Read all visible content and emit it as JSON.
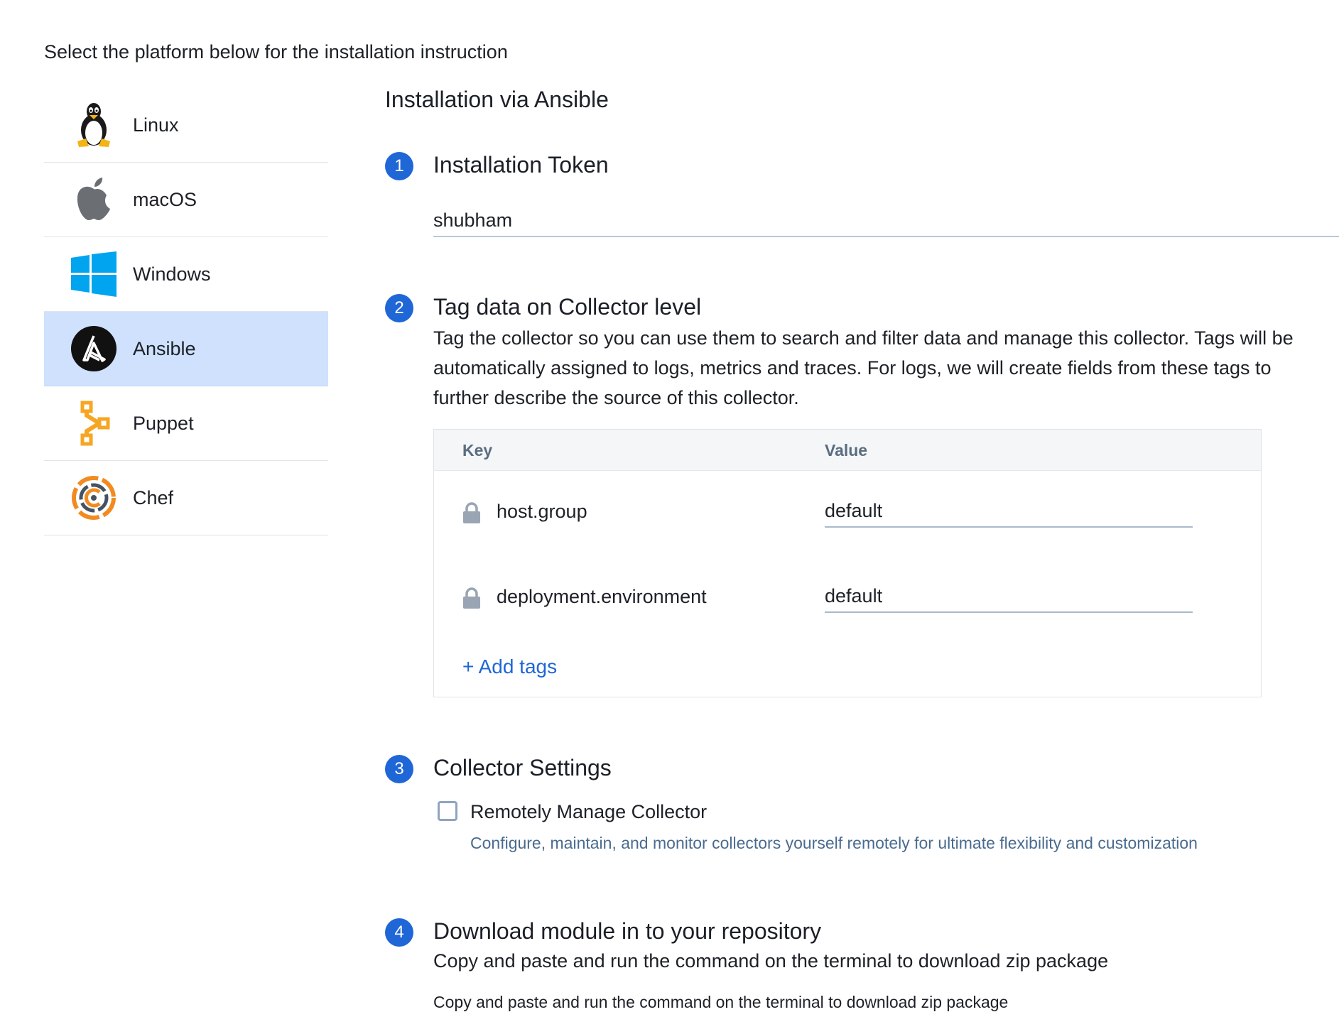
{
  "intro": "Select the platform below for the installation instruction",
  "platforms": [
    {
      "label": "Linux",
      "icon": "linux-tux-icon"
    },
    {
      "label": "macOS",
      "icon": "apple-icon"
    },
    {
      "label": "Windows",
      "icon": "windows-icon"
    },
    {
      "label": "Ansible",
      "icon": "ansible-icon",
      "selected": true
    },
    {
      "label": "Puppet",
      "icon": "puppet-icon"
    },
    {
      "label": "Chef",
      "icon": "chef-icon"
    }
  ],
  "main": {
    "title": "Installation via Ansible",
    "steps": [
      {
        "number": "1",
        "title": "Installation Token"
      },
      {
        "number": "2",
        "title": "Tag data on Collector level"
      },
      {
        "number": "3",
        "title": "Collector Settings"
      },
      {
        "number": "4",
        "title": "Download module in to your repository"
      }
    ],
    "token_value": "shubham",
    "tags_description": "Tag the collector so you can use them to search and filter data and manage this collector. Tags will be automatically assigned to logs, metrics and traces. For logs, we will create fields from these tags to further describe the source of this collector.",
    "tags_table": {
      "headers": {
        "key": "Key",
        "value": "Value"
      },
      "rows": [
        {
          "key": "host.group",
          "value": "default",
          "locked": true
        },
        {
          "key": "deployment.environment",
          "value": "default",
          "locked": true
        }
      ],
      "add_label": "+ Add tags"
    },
    "collector_settings": {
      "checkbox_label": "Remotely Manage Collector",
      "checked": false,
      "help": "Configure, maintain, and monitor collectors yourself remotely for ultimate flexibility and customization"
    },
    "download": {
      "description": "Copy and paste and run the command on the terminal to download zip package",
      "cutoff_text": "Copy and paste and run the command on the terminal to download zip package"
    }
  },
  "colors": {
    "accent": "#1f66d6",
    "selected_bg": "#cfe1fd",
    "help_text": "#4a6b8f"
  }
}
